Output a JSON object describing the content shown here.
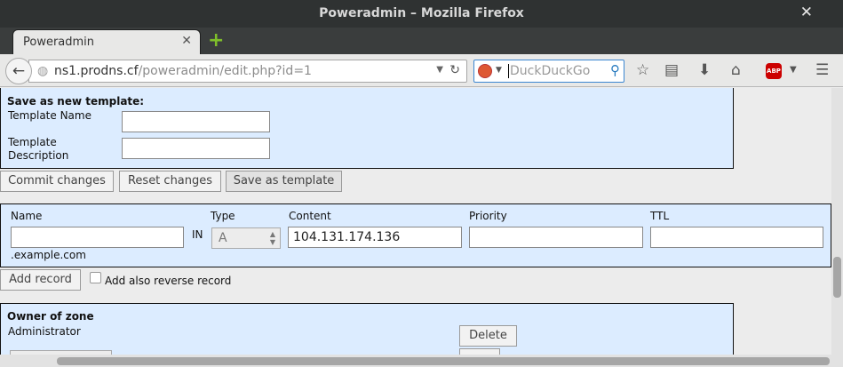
{
  "window": {
    "title": "Poweradmin – Mozilla Firefox"
  },
  "tab": {
    "label": "Poweradmin"
  },
  "navbar": {
    "url_host": "ns1.prodns.cf",
    "url_path": "/poweradmin/edit.php?id=1",
    "search_placeholder": "DuckDuckGo"
  },
  "template": {
    "heading": "Save as new template:",
    "name_label": "Template Name",
    "desc_label_1": "Template",
    "desc_label_2": "Description",
    "name_value": "",
    "desc_value": ""
  },
  "actions": {
    "commit": "Commit changes",
    "reset": "Reset changes",
    "save_template": "Save as template"
  },
  "record": {
    "col_name": "Name",
    "col_type": "Type",
    "col_content": "Content",
    "col_priority": "Priority",
    "col_ttl": "TTL",
    "in_label": "IN",
    "type_value": "A",
    "content_value": "104.131.174.136",
    "name_value": "",
    "priority_value": "",
    "ttl_value": "",
    "domain_suffix": ".example.com",
    "add_button": "Add record",
    "reverse_label": "Add also reverse record"
  },
  "owner": {
    "heading": "Owner of zone",
    "owner_name": "Administrator",
    "delete_button": "Delete"
  }
}
